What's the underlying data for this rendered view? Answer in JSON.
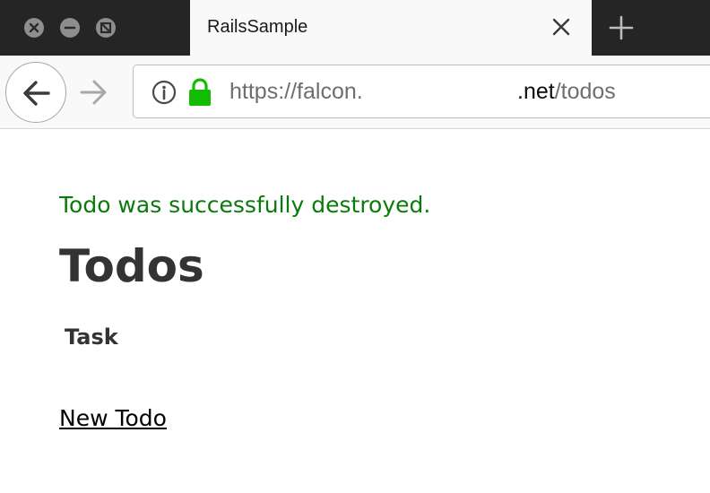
{
  "window": {
    "controls": [
      "close",
      "minimize",
      "fullscreen"
    ]
  },
  "tab": {
    "title": "RailsSample",
    "close_icon": "close-icon",
    "new_tab_icon": "plus-icon"
  },
  "navigation": {
    "back_icon": "arrow-left-icon",
    "forward_icon": "arrow-right-icon",
    "info_icon": "info-icon",
    "lock_icon": "lock-icon"
  },
  "address_bar": {
    "scheme_and_start": "https://falcon.",
    "domain_end": ".net",
    "path": "/todos"
  },
  "page": {
    "notice": "Todo was successfully destroyed.",
    "title": "Todos",
    "table_header": "Task",
    "new_link": "New Todo"
  },
  "colors": {
    "notice": "#0a7a0a",
    "lock": "#12bc00",
    "tabbar": "#252525"
  }
}
